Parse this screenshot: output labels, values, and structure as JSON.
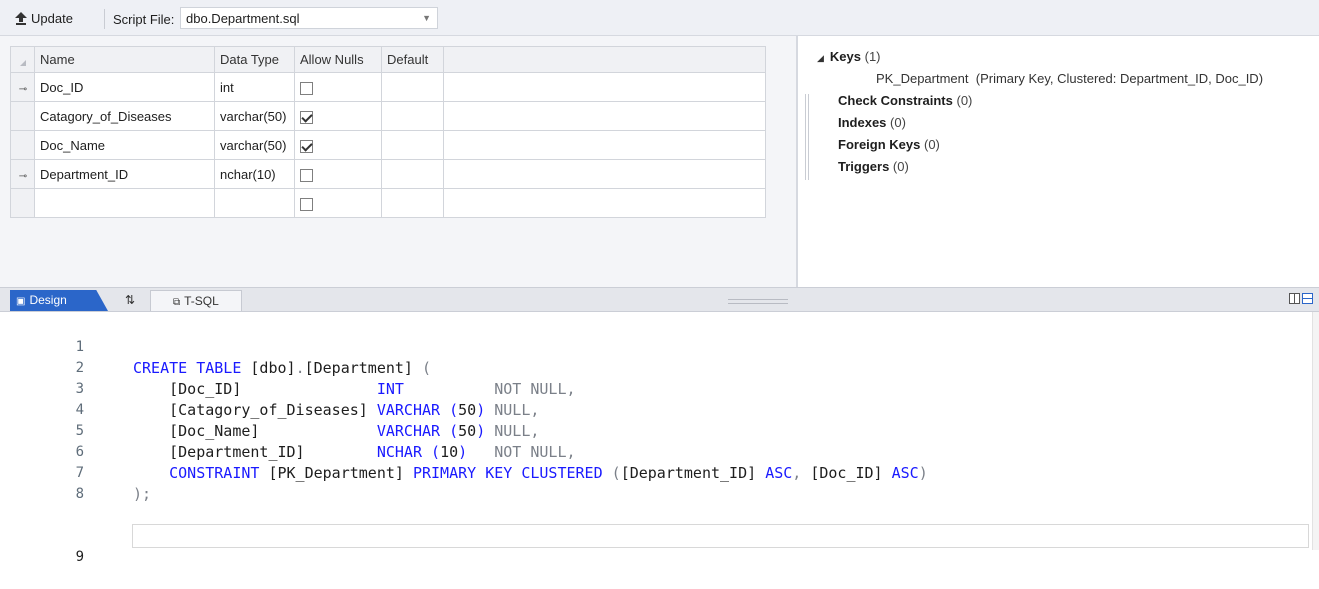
{
  "toolbar": {
    "update_label": "Update",
    "script_file_label": "Script File:",
    "script_file_value": "dbo.Department.sql"
  },
  "grid": {
    "headers": {
      "name": "Name",
      "data_type": "Data Type",
      "allow_nulls": "Allow Nulls",
      "default": "Default"
    },
    "rows": [
      {
        "key": true,
        "name": "Doc_ID",
        "data_type": "int",
        "allow_nulls": false
      },
      {
        "key": false,
        "name": "Catagory_of_Diseases",
        "data_type": "varchar(50)",
        "allow_nulls": true
      },
      {
        "key": false,
        "name": "Doc_Name",
        "data_type": "varchar(50)",
        "allow_nulls": true
      },
      {
        "key": true,
        "name": "Department_ID",
        "data_type": "nchar(10)",
        "allow_nulls": false
      },
      {
        "key": false,
        "name": "",
        "data_type": "",
        "allow_nulls": false
      }
    ]
  },
  "properties": {
    "keys_label": "Keys",
    "keys_count": "(1)",
    "pk_name": "PK_Department",
    "pk_detail": "(Primary Key, Clustered: Department_ID, Doc_ID)",
    "check_label": "Check Constraints",
    "check_count": "(0)",
    "indexes_label": "Indexes",
    "indexes_count": "(0)",
    "fk_label": "Foreign Keys",
    "fk_count": "(0)",
    "triggers_label": "Triggers",
    "triggers_count": "(0)"
  },
  "tabs": {
    "design": "Design",
    "swap": "⇅",
    "tsql": "T-SQL"
  },
  "editor": {
    "line_numbers": [
      "1",
      "2",
      "3",
      "4",
      "5",
      "6",
      "7",
      "8",
      "9"
    ],
    "l1": {
      "a": "CREATE TABLE",
      "b": " [dbo]",
      "c": ".",
      "d": "[Department] ",
      "e": "("
    },
    "l2": {
      "a": "    [Doc_ID]               ",
      "b": "INT",
      "c": "          NOT NULL",
      "d": ","
    },
    "l3": {
      "a": "    [Catagory_of_Diseases] ",
      "b": "VARCHAR (",
      "c": "50",
      "d": ")",
      "e": " NULL",
      "f": ","
    },
    "l4": {
      "a": "    [Doc_Name]             ",
      "b": "VARCHAR (",
      "c": "50",
      "d": ")",
      "e": " NULL",
      "f": ","
    },
    "l5": {
      "a": "    [Department_ID]        ",
      "b": "NCHAR (",
      "c": "10",
      "d": ")",
      "e": "   NOT NULL",
      "f": ","
    },
    "l6": {
      "a": "    CONSTRAINT",
      "b": " [PK_Department] ",
      "c": "PRIMARY KEY CLUSTERED",
      "d": " (",
      "e": "[Department_ID] ",
      "f": "ASC",
      "g": ", ",
      "h": "[Doc_ID] ",
      "i": "ASC",
      "j": ")"
    },
    "l7": {
      "a": ")",
      "b": ";"
    }
  },
  "colors": {
    "accent": "#2b66c9",
    "keyword": "#1a1aff",
    "gray_text": "#7b8089"
  }
}
